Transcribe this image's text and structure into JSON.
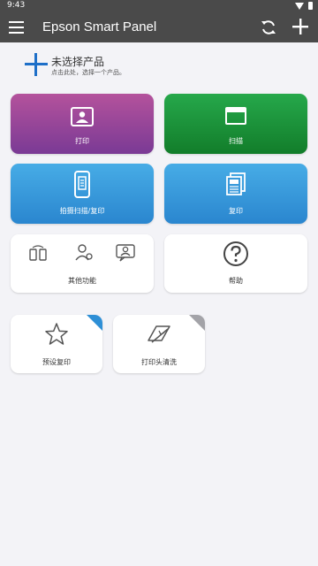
{
  "status_bar": {
    "time": "9:43"
  },
  "app_bar": {
    "title": "Epson Smart Panel"
  },
  "product": {
    "title": "未选择产品",
    "subtitle": "点击此处，选择一个产品。"
  },
  "tiles": {
    "print": "打印",
    "scan": "扫描",
    "photo_scan_copy": "拍摄扫描/复印",
    "copy": "复印",
    "other": "其他功能",
    "help": "帮助",
    "preset_copy": "预设复印",
    "head_clean": "打印头清洗"
  },
  "colors": {
    "app_bar": "#4a4a4a",
    "background": "#f3f3f7",
    "print_tile": "#9a4a9c",
    "scan_tile": "#1e9a3e",
    "copy_tile": "#3a9adb",
    "accent_blue": "#1e6fc8"
  }
}
